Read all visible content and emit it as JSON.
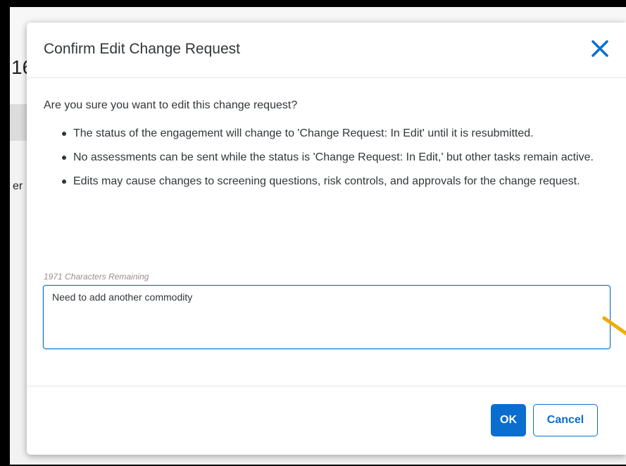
{
  "background": {
    "partial_number": "16",
    "partial_text": "er"
  },
  "dialog": {
    "title": "Confirm Edit Change Request",
    "close_icon": "close-icon",
    "question": "Are you sure you want to edit this change request?",
    "bullets": [
      "The status of the engagement will change to 'Change Request: In Edit' until it is resubmitted.",
      "No assessments can be sent while the status is 'Change Request: In Edit,' but other tasks remain active.",
      "Edits may cause changes to screening questions, risk controls, and approvals for the change request."
    ],
    "char_count": "1971 Characters Remaining",
    "textarea_value": "Need to add another commodity",
    "ok_label": "OK",
    "cancel_label": "Cancel"
  },
  "colors": {
    "accent": "#0a6ed1",
    "text": "#32363a",
    "highlight": "#f0ab00"
  }
}
